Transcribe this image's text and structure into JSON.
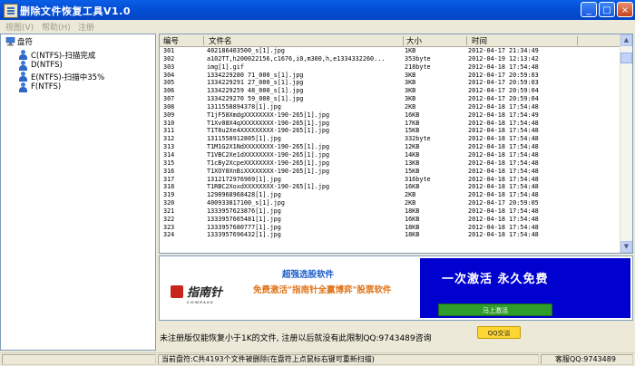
{
  "window": {
    "title": "删除文件恢复工具V1.0"
  },
  "titlebar_buttons": {
    "minimize": "_",
    "maximize": "□",
    "close": "×"
  },
  "menu": [
    "视图(V)",
    "帮助(H)",
    "注册"
  ],
  "sidebar": {
    "root": "盘符",
    "drives": [
      {
        "label": "C(NTFS)-扫描完成"
      },
      {
        "label": "D(NTFS)"
      },
      {
        "label": "E(NTFS)-扫描中35%"
      },
      {
        "label": "F(NTFS)"
      }
    ]
  },
  "file_list": {
    "columns": {
      "num": "编号",
      "name": "文件名",
      "size": "大小",
      "time": "时间"
    },
    "rows": [
      [
        "301",
        "402186403500_s[1].jpg",
        "1KB",
        "2012-04-17  21:34:49"
      ],
      [
        "302",
        "a102TT,h200022156,c1676,i0,m300,h,e1334332260...",
        "353byte",
        "2012-04-19  12:13:42"
      ],
      [
        "303",
        "img[1].gif",
        "218byte",
        "2012-04-18  17:54:48"
      ],
      [
        "304",
        "1334229280 71_000_s[1].jpg",
        "3KB",
        "2012-04-17  20:59:03"
      ],
      [
        "305",
        "1334229291 27_000_s[1].jpg",
        "3KB",
        "2012-04-17  20:59:03"
      ],
      [
        "306",
        "1334229259 48_000_s[1].jpg",
        "3KB",
        "2012-04-17  20:59:04"
      ],
      [
        "307",
        "1334229270 59_000_s[1].jpg",
        "3KB",
        "2012-04-17  20:59:04"
      ],
      [
        "308",
        "1311558894378[1].jpg",
        "2KB",
        "2012-04-18  17:54:48"
      ],
      [
        "309",
        "T1jF58XmdgXXXXXXXX-190-265[1].jpg",
        "16KB",
        "2012-04-18  17:54:49"
      ],
      [
        "310",
        "T1Xv08X4qXXXXXXXXX-190-265[1].jpg",
        "17KB",
        "2012-04-18  17:54:48"
      ],
      [
        "311",
        "T1T8u2Xe4XXXXXXXXX-190-265[1].jpg",
        "15KB",
        "2012-04-18  17:54:48"
      ],
      [
        "312",
        "1311558912805[1].jpg",
        "332byte",
        "2012-04-18  17:54:48"
      ],
      [
        "313",
        "T1M1G2X1NdXXXXXXXX-190-265[1].jpg",
        "12KB",
        "2012-04-18  17:54:48"
      ],
      [
        "314",
        "T1VBC2Xe1dXXXXXXXX-190-265[1].jpg",
        "14KB",
        "2012-04-18  17:54:48"
      ],
      [
        "315",
        "T1cBy2XcpeXXXXXXXX-190-265[1].jpg",
        "13KB",
        "2012-04-18  17:54:48"
      ],
      [
        "316",
        "T1XOY8XnBiXXXXXXXX-190-265[1].jpg",
        "15KB",
        "2012-04-18  17:54:48"
      ],
      [
        "317",
        "1312172976969[1].jpg",
        "316byte",
        "2012-04-18  17:54:48"
      ],
      [
        "318",
        "T1RBC2XoxdXXXXXXXX-190-265[1].jpg",
        "16KB",
        "2012-04-18  17:54:48"
      ],
      [
        "319",
        "1298968968428[1].jpg",
        "2KB",
        "2012-04-18  17:54:48"
      ],
      [
        "320",
        "400933817100_s[1].jpg",
        "2KB",
        "2012-04-17  20:59:05"
      ],
      [
        "321",
        "1333957623876[1].jpg",
        "18KB",
        "2012-04-18  17:54:48"
      ],
      [
        "322",
        "1333957665481[1].jpg",
        "16KB",
        "2012-04-18  17:54:48"
      ],
      [
        "323",
        "1333957680777[1].jpg",
        "18KB",
        "2012-04-18  17:54:48"
      ],
      [
        "324",
        "1333957696432[1].jpg",
        "18KB",
        "2012-04-18  17:54:48"
      ]
    ]
  },
  "scrollbar": {
    "up": "▲",
    "down": "▼",
    "right": "▶"
  },
  "ad": {
    "logo": "指南针",
    "logo_sub": "COMPASS",
    "headline": "超强选股软件",
    "subline": "免费激活\"指南针全赢博弈\"股票软件",
    "slogan": "一次激活  永久免费",
    "button": "马上激活"
  },
  "notice": "未注册版仅能恢复小于1K的文件, 注册以后就没有此限制QQ:9743489咨询",
  "qq_button": "QQ交谈",
  "status": {
    "current": "当前盘符:C共4193个文件被删除(在盘符上点鼠标右键可重新扫描)",
    "support": "客服QQ:9743489"
  },
  "colors": {
    "titlebar": "#0450d8",
    "ad_blue": "#0000cf",
    "ad_orange": "#e0741a",
    "ad_green": "#2f9d2a"
  }
}
